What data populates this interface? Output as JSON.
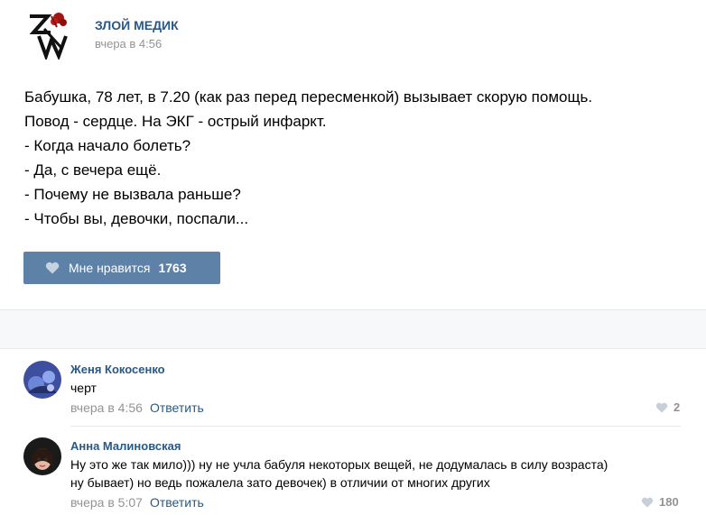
{
  "post": {
    "author": "ЗЛОЙ МЕДИК",
    "time": "вчера в 4:56",
    "lines": [
      "Бабушка, 78 лет, в 7.20 (как раз перед пересменкой) вызывает скорую помощь.",
      "Повод - сердце. На ЭКГ - острый инфаркт.",
      "- Когда начало болеть?",
      "- Да, с вечера ещё.",
      "- Почему не вызвала раньше?",
      "- Чтобы вы, девочки, поспали..."
    ],
    "like_label": "Мне нравится",
    "like_count": "1763",
    "accent": "#5e81a8"
  },
  "comments": [
    {
      "name": "Женя Кокосенко",
      "text": "черт",
      "time": "вчера в 4:56",
      "reply": "Ответить",
      "likes": "2"
    },
    {
      "name": "Анна Малиновская",
      "text_line1": "Ну это же так мило))) ну не учла бабуля некоторых вещей, не додумалась в силу возраста)",
      "text_line2": "ну бывает) но ведь пожалела зато девочек) в отличии от многих других",
      "time": "вчера в 5:07",
      "reply": "Ответить",
      "likes": "180"
    }
  ],
  "icons": {
    "like": "heart-icon",
    "logo": "zm-logo"
  }
}
